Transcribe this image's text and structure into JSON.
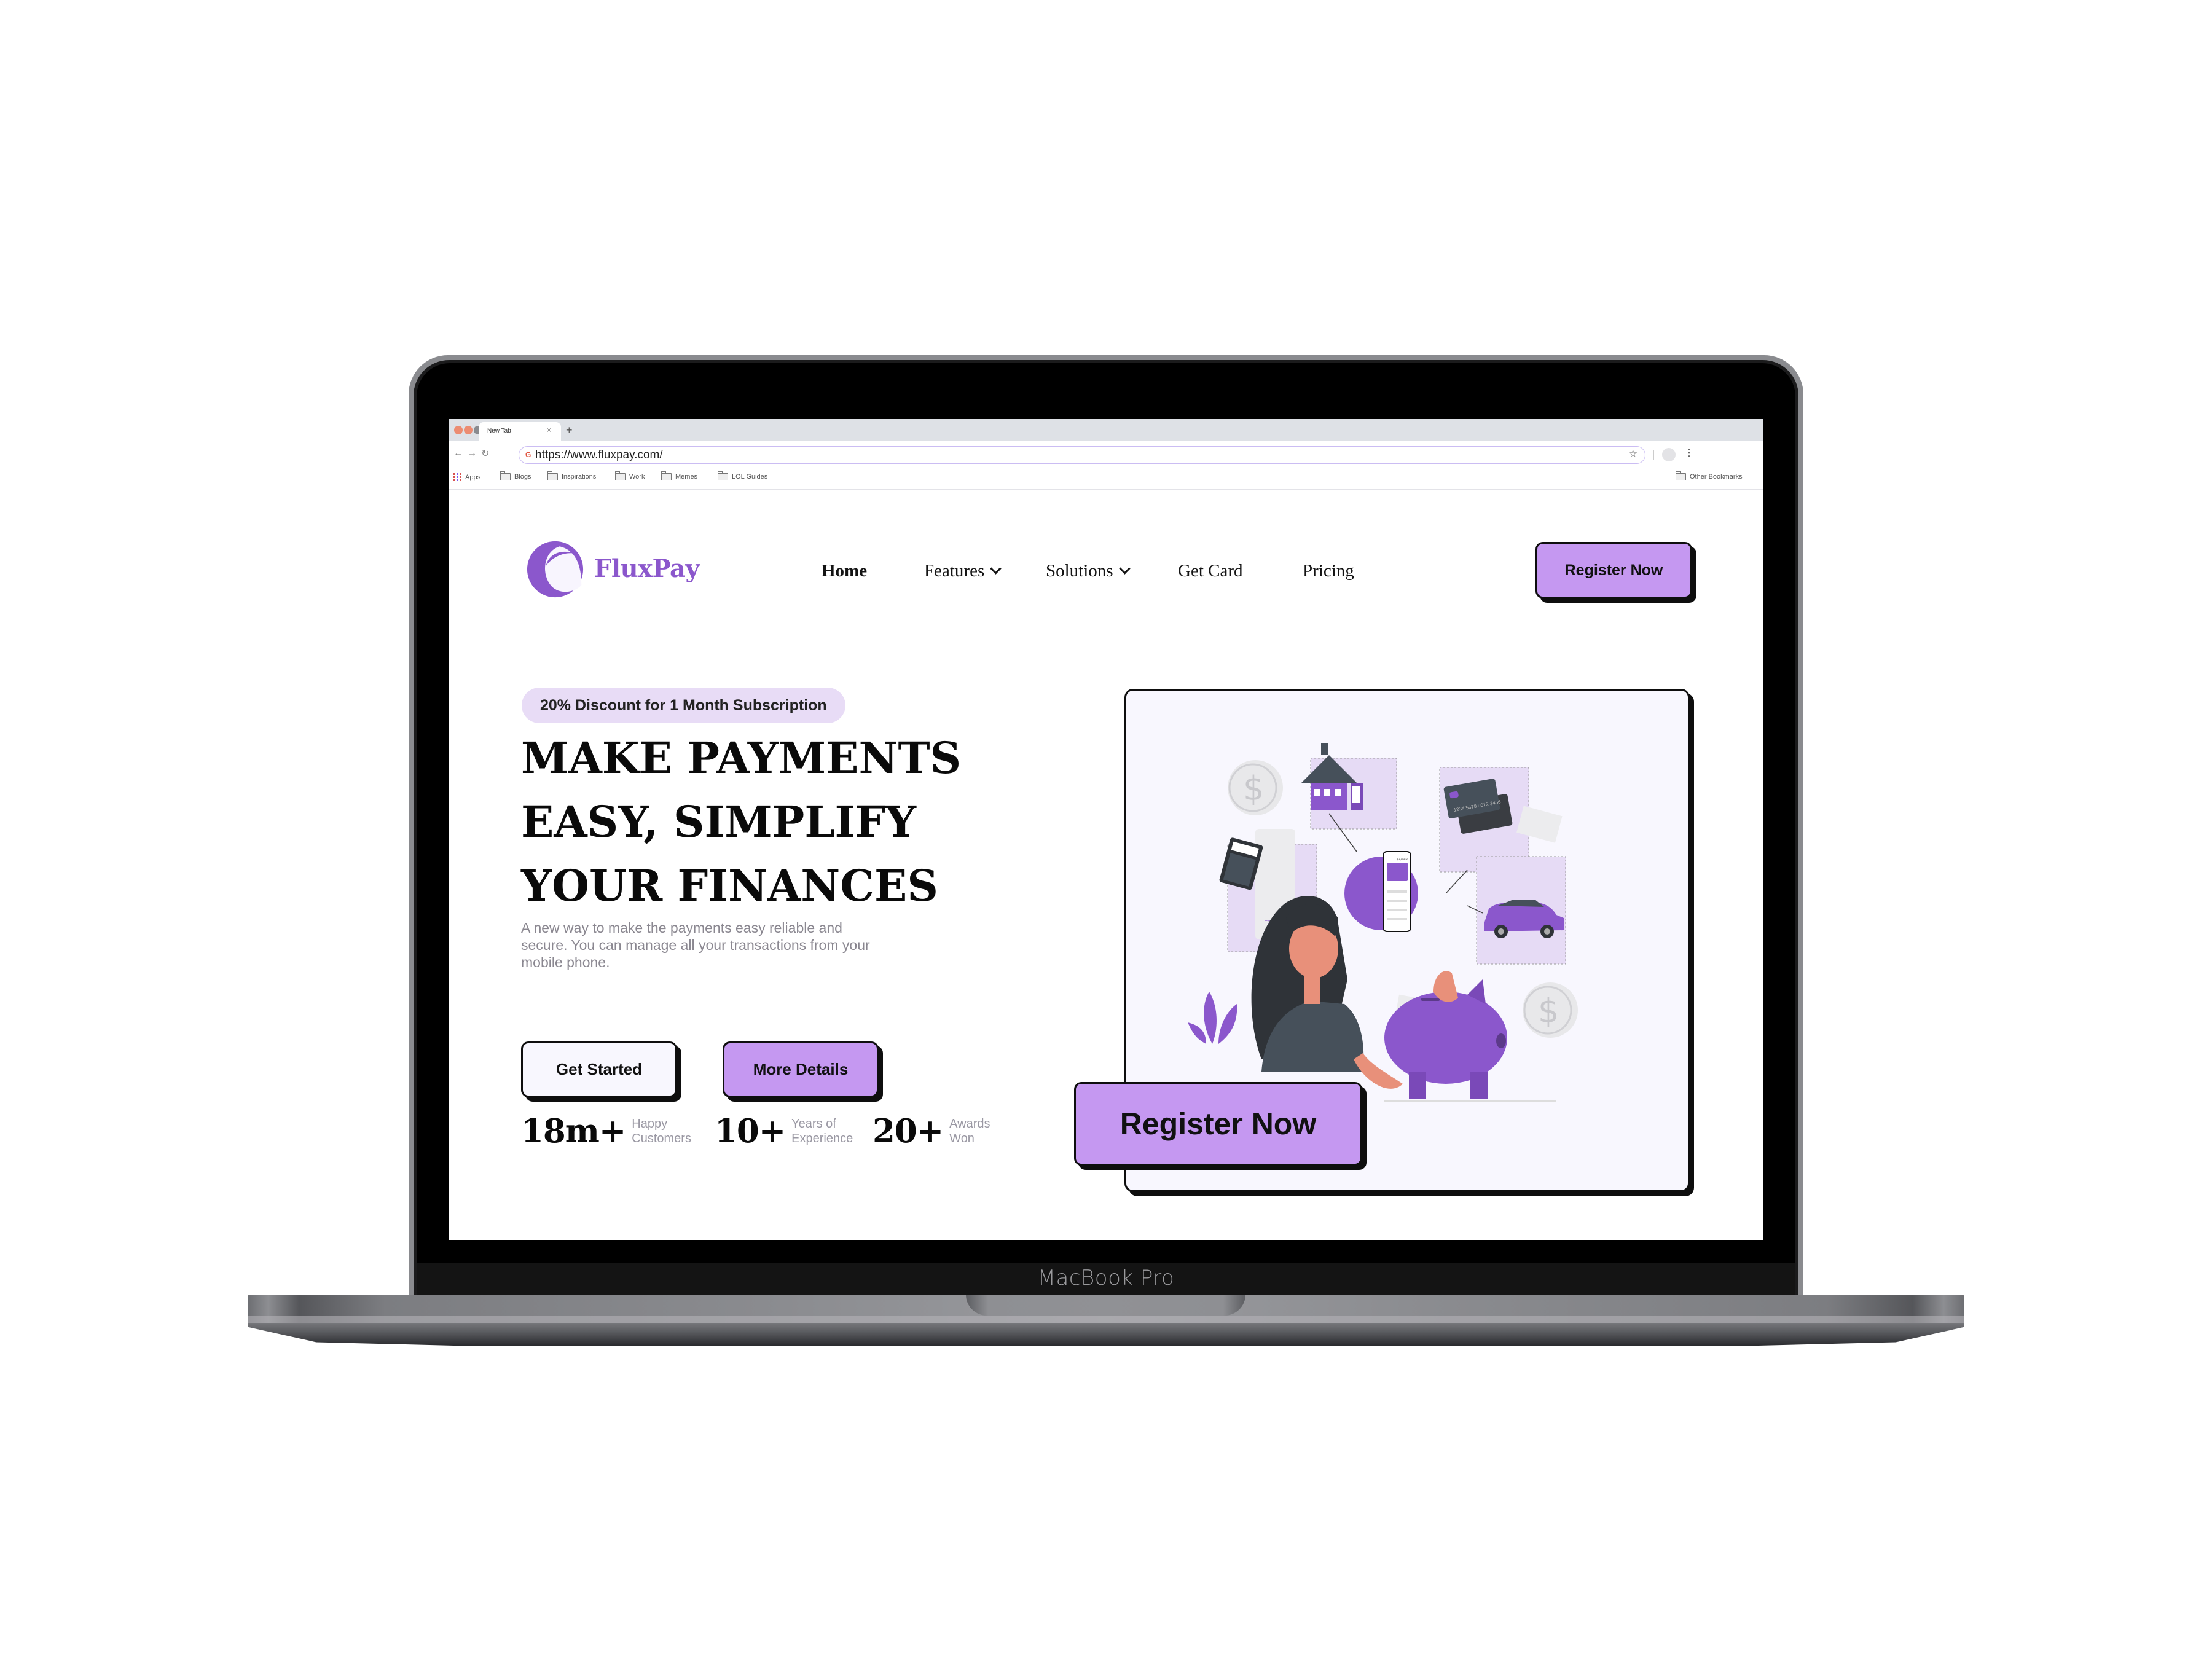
{
  "device": {
    "label": "MacBook Pro"
  },
  "browser": {
    "tab_title": "New Tab",
    "tab_close": "×",
    "new_tab": "+",
    "url": "https://www.fluxpay.com/",
    "bookmarks": [
      "Apps",
      "Blogs",
      "Inspirations",
      "Work",
      "Memes",
      "LOL Guides"
    ],
    "other_bookmarks": "Other Bookmarks",
    "traffic_lights": [
      "#ec8c72",
      "#ec8c72",
      "#8a8b8f"
    ]
  },
  "site": {
    "brand": "FluxPay",
    "brand_color": "#8b57cc",
    "accent_color": "#c598f1",
    "nav": [
      {
        "label": "Home",
        "active": true,
        "dropdown": false
      },
      {
        "label": "Features",
        "active": false,
        "dropdown": true
      },
      {
        "label": "Solutions",
        "active": false,
        "dropdown": true
      },
      {
        "label": "Get Card",
        "active": false,
        "dropdown": false
      },
      {
        "label": "Pricing",
        "active": false,
        "dropdown": false
      }
    ],
    "register_top": "Register Now",
    "hero": {
      "badge": "20% Discount for 1 Month Subscription",
      "title_lines": [
        "MAKE PAYMENTS",
        "EASY, SIMPLIFY",
        "YOUR FINANCES"
      ],
      "description_lines": [
        "A new way to make the payments easy reliable and",
        "secure. You can manage all your transactions from your",
        "mobile phone."
      ],
      "get_started": "Get Started",
      "more_details": "More Details"
    },
    "stats": [
      {
        "value": "18m+",
        "label_lines": [
          "Happy",
          "Customers"
        ]
      },
      {
        "value": "10+",
        "label_lines": [
          "Years of",
          "Experience"
        ]
      },
      {
        "value": "20+",
        "label_lines": [
          "Awards",
          "Won"
        ]
      }
    ],
    "illustration": {
      "phone_balance": "$ 4,658.50",
      "card_number": "1234 5678 9012 3456",
      "receipt_total": "TOTAL: $"
    },
    "register_big": "Register Now"
  }
}
